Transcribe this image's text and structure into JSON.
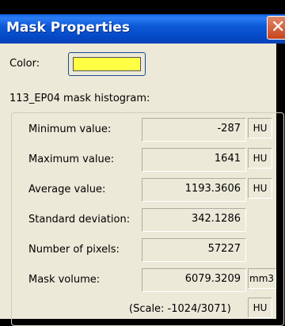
{
  "dialog": {
    "title": "Mask Properties",
    "close_symbol": "✕"
  },
  "color": {
    "label": "Color:",
    "swatch_color": "#ffff44"
  },
  "histogram": {
    "heading": "113_EP04 mask histogram:",
    "rows": [
      {
        "label": "Minimum value:",
        "value": "-287",
        "unit": "HU"
      },
      {
        "label": "Maximum value:",
        "value": "1641",
        "unit": "HU"
      },
      {
        "label": "Average value:",
        "value": "1193.3606",
        "unit": "HU"
      },
      {
        "label": "Standard deviation:",
        "value": "342.1286",
        "unit": ""
      },
      {
        "label": "Number of pixels:",
        "value": "57227",
        "unit": ""
      },
      {
        "label": "Mask volume:",
        "value": "6079.3209",
        "unit": "mm3"
      }
    ],
    "scale": {
      "value": "(Scale: -1024/3071)",
      "unit": "HU"
    }
  },
  "colors": {
    "titlebar": "#0a4fd0",
    "window_bg": "#ece9d8",
    "close_button": "#d2522a"
  }
}
